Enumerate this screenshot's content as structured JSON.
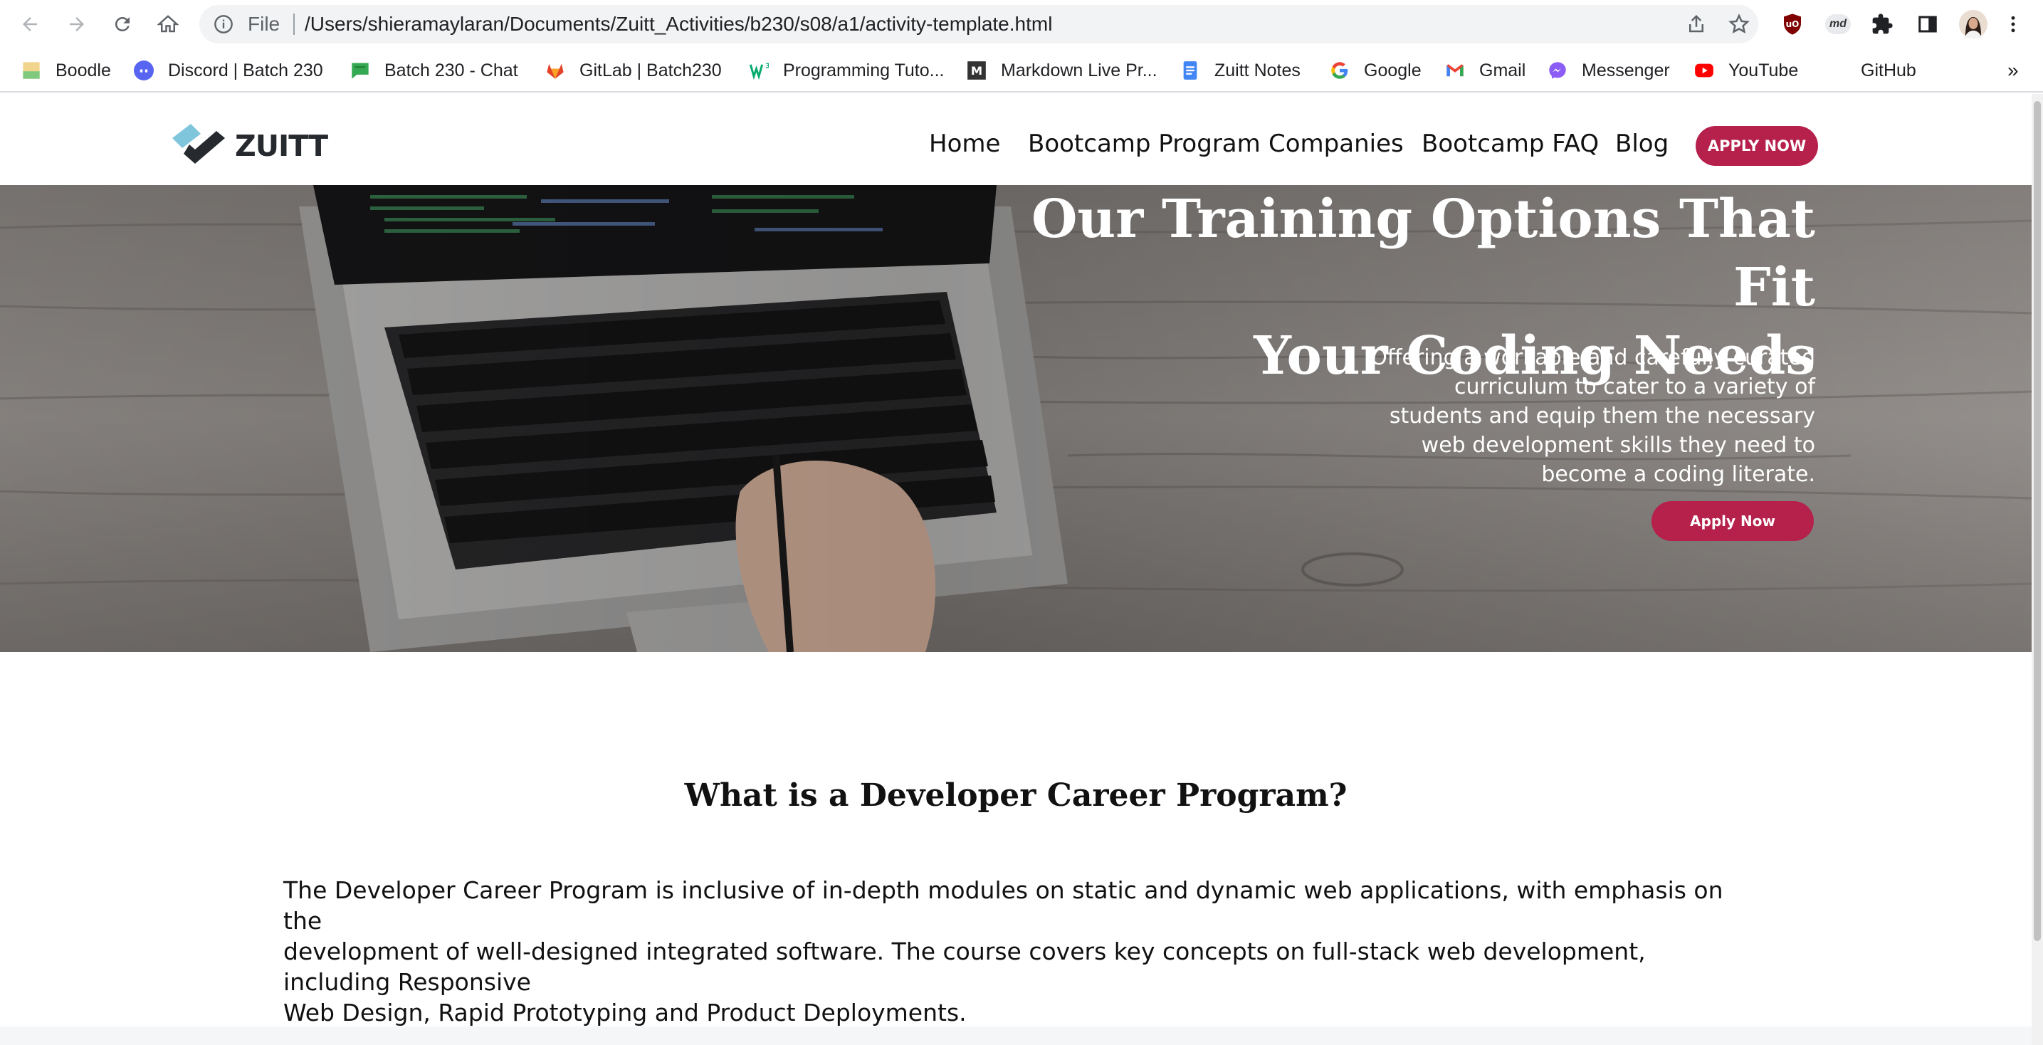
{
  "browser": {
    "scheme": "File",
    "url": "/Users/shieramaylaran/Documents/Zuitt_Activities/b230/s08/a1/activity-template.html",
    "bookmarks": [
      {
        "label": "Boodle",
        "icon": "boodle-icon"
      },
      {
        "label": "Discord | Batch 230",
        "icon": "discord-icon"
      },
      {
        "label": "Batch 230 - Chat",
        "icon": "chat-icon"
      },
      {
        "label": "GitLab | Batch230",
        "icon": "gitlab-icon"
      },
      {
        "label": "Programming Tuto...",
        "icon": "w3-icon"
      },
      {
        "label": "Markdown Live Pr...",
        "icon": "markdown-icon"
      },
      {
        "label": "Zuitt Notes",
        "icon": "docs-icon"
      },
      {
        "label": "Google",
        "icon": "google-icon"
      },
      {
        "label": "Gmail",
        "icon": "gmail-icon"
      },
      {
        "label": "Messenger",
        "icon": "messenger-icon"
      },
      {
        "label": "YouTube",
        "icon": "youtube-icon"
      },
      {
        "label": "GitHub",
        "icon": "github-icon"
      }
    ],
    "more": "»",
    "ext_md": "md"
  },
  "site": {
    "logo": "ZUITT",
    "nav": [
      "Home",
      "Bootcamp Program",
      "Companies",
      "Bootcamp FAQ",
      "Blog"
    ],
    "apply_top": "APPLY NOW",
    "accent_color": "#b5214b"
  },
  "hero": {
    "title_line1": "Our Training Options That Fit",
    "title_line2": "Your Coding Needs",
    "lines": [
      "Offering a workable and carefully curated",
      "curriculum to cater to a variety of",
      "students and equip them the necessary",
      "web development skills they need to",
      "become a coding literate."
    ],
    "button": "Apply Now"
  },
  "section": {
    "title": "What is a Developer Career Program?",
    "lines": [
      "The Developer Career Program is inclusive of in-depth modules on static and dynamic web applications, with emphasis on the",
      "development of well-designed integrated software. The course covers key concepts on full-stack web development, including Responsive",
      "Web Design, Rapid Prototyping and Product Deployments."
    ]
  }
}
